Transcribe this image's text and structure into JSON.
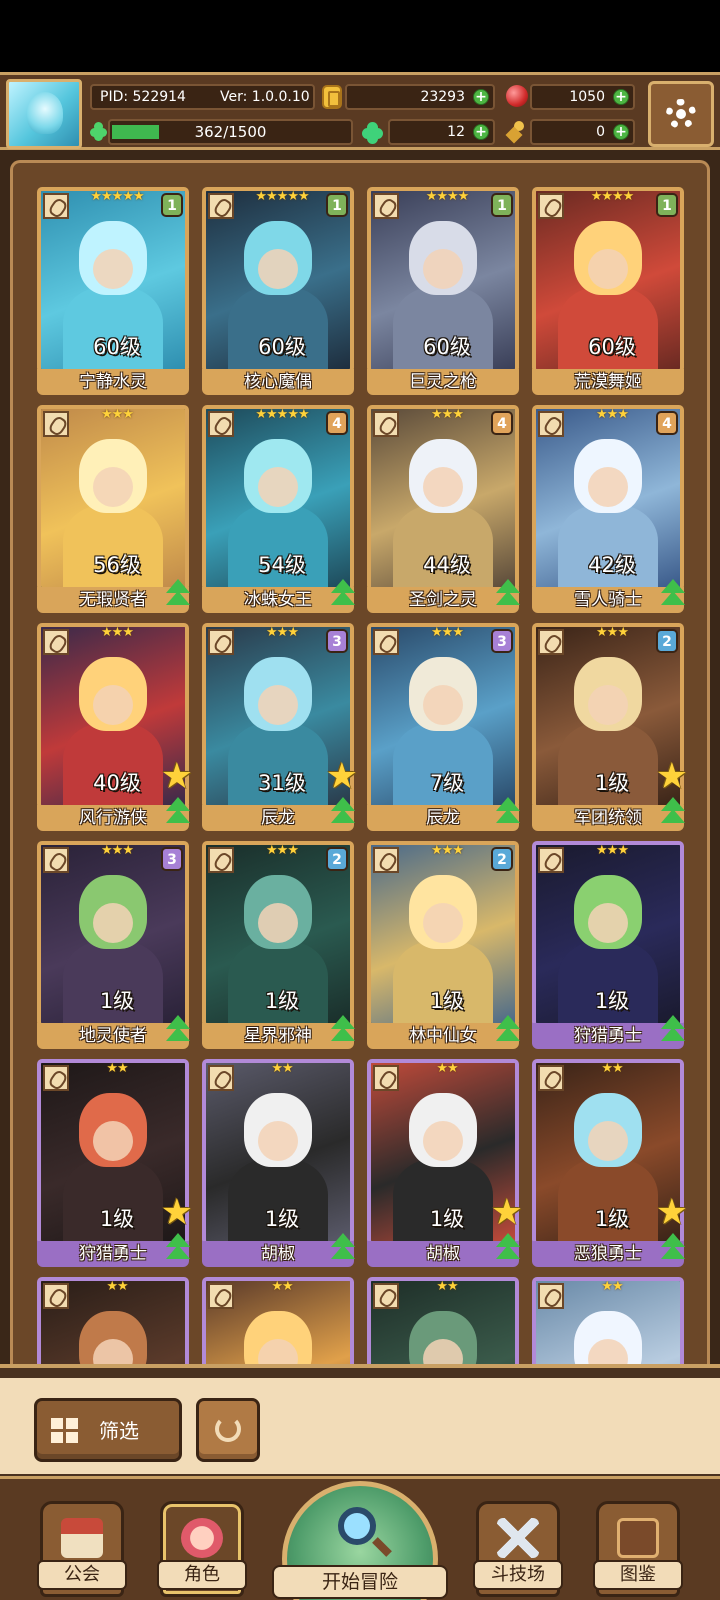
{
  "player": {
    "pid": "PID: 522914",
    "version": "Ver: 1.0.0.10",
    "gold": "23293",
    "gems": "1050",
    "energy_text": "362/1500",
    "energy_fraction": 0.24,
    "clovers": "12",
    "keys": "0"
  },
  "heroes": [
    {
      "name": "宁静水灵",
      "level": "60级",
      "stars": "★★★★★",
      "rank": "1",
      "rank_color": "green",
      "frame": "gold",
      "palette": [
        "#bff3ff",
        "#5ec9e0",
        "#2f8fb0"
      ],
      "upgrade": false,
      "bigstar": false
    },
    {
      "name": "核心魔偶",
      "level": "60级",
      "stars": "★★★★★",
      "rank": "1",
      "rank_color": "green",
      "frame": "gold",
      "palette": [
        "#7fd8e8",
        "#3a6f8a",
        "#1e2e3e"
      ],
      "upgrade": false,
      "bigstar": false
    },
    {
      "name": "巨灵之枪",
      "level": "60级",
      "stars": "★★★★",
      "rank": "1",
      "rank_color": "green",
      "frame": "gold",
      "palette": [
        "#d8dce8",
        "#7b86a0",
        "#3a3f58"
      ],
      "upgrade": false,
      "bigstar": false
    },
    {
      "name": "荒漠舞姬",
      "level": "60级",
      "stars": "★★★★",
      "rank": "1",
      "rank_color": "green",
      "frame": "gold",
      "palette": [
        "#ffd27a",
        "#d04a3a",
        "#6a2a22"
      ],
      "upgrade": false,
      "bigstar": false
    },
    {
      "name": "无瑕贤者",
      "level": "56级",
      "stars": "★★★",
      "rank": "",
      "rank_color": "",
      "frame": "gold",
      "palette": [
        "#fff0b8",
        "#f0c25a",
        "#c08a4a"
      ],
      "upgrade": true,
      "bigstar": false
    },
    {
      "name": "冰蛛女王",
      "level": "54级",
      "stars": "★★★★★",
      "rank": "4",
      "rank_color": "orange",
      "frame": "gold",
      "palette": [
        "#9fe8f0",
        "#3aa0b8",
        "#1e4a5a"
      ],
      "upgrade": true,
      "bigstar": false
    },
    {
      "name": "圣剑之灵",
      "level": "44级",
      "stars": "★★★",
      "rank": "4",
      "rank_color": "orange",
      "frame": "gold",
      "palette": [
        "#eef2f8",
        "#c8a86a",
        "#5a4a3a"
      ],
      "upgrade": true,
      "bigstar": false
    },
    {
      "name": "雪人骑士",
      "level": "42级",
      "stars": "★★★",
      "rank": "4",
      "rank_color": "orange",
      "frame": "gold",
      "palette": [
        "#eef6ff",
        "#8fb6d8",
        "#3a5a8a"
      ],
      "upgrade": true,
      "bigstar": false
    },
    {
      "name": "风行游侠",
      "level": "40级",
      "stars": "★★★",
      "rank": "",
      "rank_color": "",
      "frame": "gold",
      "palette": [
        "#ffd27a",
        "#c03a3a",
        "#3a2a4a"
      ],
      "upgrade": true,
      "bigstar": true
    },
    {
      "name": "辰龙",
      "level": "31级",
      "stars": "★★★",
      "rank": "3",
      "rank_color": "purple",
      "frame": "gold",
      "palette": [
        "#9fe0f0",
        "#3a8aa0",
        "#2a3a4a"
      ],
      "upgrade": true,
      "bigstar": true
    },
    {
      "name": "辰龙",
      "level": "7级",
      "stars": "★★★",
      "rank": "3",
      "rank_color": "purple",
      "frame": "gold",
      "palette": [
        "#f0ead8",
        "#5aa0c8",
        "#2a4a6a"
      ],
      "upgrade": true,
      "bigstar": false
    },
    {
      "name": "军团统领",
      "level": "1级",
      "stars": "★★★",
      "rank": "2",
      "rank_color": "blue",
      "frame": "gold",
      "palette": [
        "#f0d8a0",
        "#8a5a3a",
        "#3a2418"
      ],
      "upgrade": true,
      "bigstar": true
    },
    {
      "name": "地灵使者",
      "level": "1级",
      "stars": "★★★",
      "rank": "3",
      "rank_color": "purple",
      "frame": "gold",
      "palette": [
        "#8ac870",
        "#4a3a5a",
        "#2a2238"
      ],
      "upgrade": true,
      "bigstar": false
    },
    {
      "name": "星界邪神",
      "level": "1级",
      "stars": "★★★",
      "rank": "2",
      "rank_color": "blue",
      "frame": "gold",
      "palette": [
        "#6ab0a0",
        "#2a5a50",
        "#1a2e2a"
      ],
      "upgrade": true,
      "bigstar": false
    },
    {
      "name": "林中仙女",
      "level": "1级",
      "stars": "★★★",
      "rank": "2",
      "rank_color": "blue",
      "frame": "gold",
      "palette": [
        "#ffe4a0",
        "#d8b86a",
        "#4a6a8a"
      ],
      "upgrade": true,
      "bigstar": false
    },
    {
      "name": "狩猎勇士",
      "level": "1级",
      "stars": "★★★",
      "rank": "",
      "rank_color": "",
      "frame": "purple",
      "palette": [
        "#8ad070",
        "#2a2a5a",
        "#1a1a2e"
      ],
      "upgrade": true,
      "bigstar": false
    },
    {
      "name": "狩猎勇士",
      "level": "1级",
      "stars": "★★",
      "rank": "",
      "rank_color": "",
      "frame": "purple",
      "palette": [
        "#e06a4a",
        "#3a2a2a",
        "#1e1818"
      ],
      "upgrade": true,
      "bigstar": true
    },
    {
      "name": "胡椒",
      "level": "1级",
      "stars": "★★",
      "rank": "",
      "rank_color": "",
      "frame": "purple",
      "palette": [
        "#f0f0f0",
        "#2a2a2a",
        "#5a5a6a"
      ],
      "upgrade": true,
      "bigstar": false
    },
    {
      "name": "胡椒",
      "level": "1级",
      "stars": "★★",
      "rank": "",
      "rank_color": "",
      "frame": "purple",
      "palette": [
        "#f0f0f0",
        "#2a2a2a",
        "#c04a3a"
      ],
      "upgrade": true,
      "bigstar": true
    },
    {
      "name": "恶狼勇士",
      "level": "1级",
      "stars": "★★",
      "rank": "",
      "rank_color": "",
      "frame": "purple",
      "palette": [
        "#9fe0f0",
        "#8a4a2a",
        "#3a2418"
      ],
      "upgrade": true,
      "bigstar": true
    },
    {
      "name": "",
      "level": "",
      "stars": "★★",
      "rank": "",
      "rank_color": "",
      "frame": "purple",
      "palette": [
        "#c07a4a",
        "#5a3a2a",
        "#2a1e18"
      ],
      "upgrade": false,
      "bigstar": false
    },
    {
      "name": "",
      "level": "",
      "stars": "★★",
      "rank": "",
      "rank_color": "",
      "frame": "purple",
      "palette": [
        "#ffd27a",
        "#e0a04a",
        "#5a3a2a"
      ],
      "upgrade": false,
      "bigstar": false
    },
    {
      "name": "",
      "level": "",
      "stars": "★★",
      "rank": "",
      "rank_color": "",
      "frame": "purple",
      "palette": [
        "#6a9a7a",
        "#3a5a4a",
        "#1e2e28"
      ],
      "upgrade": false,
      "bigstar": false
    },
    {
      "name": "",
      "level": "",
      "stars": "★★",
      "rank": "",
      "rank_color": "",
      "frame": "purple",
      "palette": [
        "#f0f6ff",
        "#b8cce0",
        "#6a8aa8"
      ],
      "upgrade": false,
      "bigstar": false
    }
  ],
  "filter": {
    "label": "筛选"
  },
  "nav": {
    "guild": "公会",
    "character": "角色",
    "adventure": "开始冒险",
    "arena": "斗技场",
    "codex": "图鉴"
  }
}
